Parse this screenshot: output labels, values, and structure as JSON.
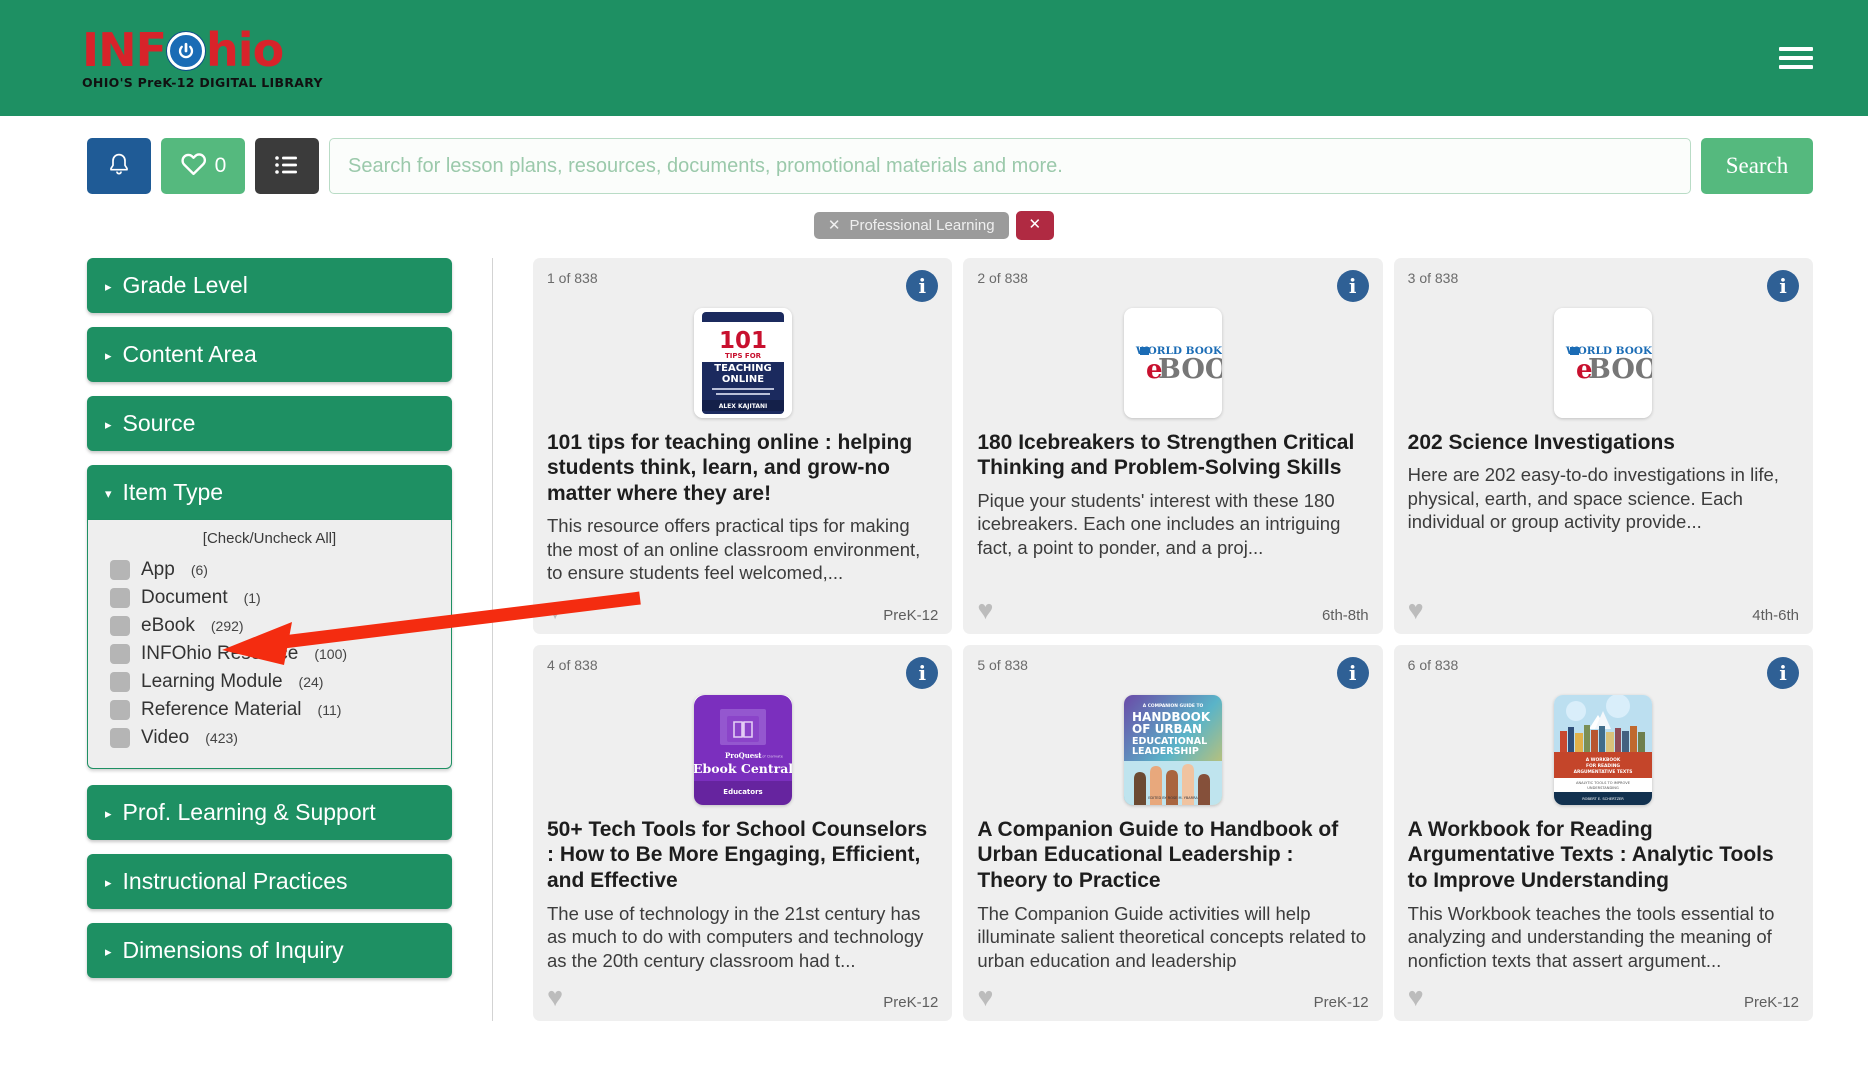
{
  "header": {
    "logo_main": "INF",
    "logo_tail": "hio",
    "logo_icon": "power-icon",
    "logo_tagline": "OHIO'S PreK-12 DIGITAL LIBRARY",
    "menu_icon": "hamburger-icon",
    "brand_green": "#1e9063",
    "brand_red": "#d8232a",
    "brand_blue": "#1a6cb5"
  },
  "search": {
    "notifications_icon": "bell-icon",
    "favorites_icon": "heart-icon",
    "favorites_count": "0",
    "list_icon": "list-icon",
    "placeholder": "Search for lesson plans, resources, documents, promotional materials and more.",
    "value": "",
    "submit_label": "Search"
  },
  "filters": {
    "chips": [
      {
        "label": "Professional Learning",
        "remove_icon": "close-icon"
      }
    ],
    "clear_all_icon": "close-icon",
    "clear_all_color": "#b02a42"
  },
  "sidebar": {
    "facets": [
      {
        "label": "Grade Level",
        "expanded": false,
        "marker": "▸"
      },
      {
        "label": "Content Area",
        "expanded": false,
        "marker": "▸"
      },
      {
        "label": "Source",
        "expanded": false,
        "marker": "▸"
      },
      {
        "label": "Item Type",
        "expanded": true,
        "marker": "▾"
      },
      {
        "label": "Prof. Learning & Support",
        "expanded": false,
        "marker": "▸"
      },
      {
        "label": "Instructional Practices",
        "expanded": false,
        "marker": "▸"
      },
      {
        "label": "Dimensions of Inquiry",
        "expanded": false,
        "marker": "▸"
      }
    ],
    "item_type": {
      "check_all_label": "[Check/Uncheck All]",
      "options": [
        {
          "label": "App",
          "count": "(6)",
          "checked": false
        },
        {
          "label": "Document",
          "count": "(1)",
          "checked": false
        },
        {
          "label": "eBook",
          "count": "(292)",
          "checked": false
        },
        {
          "label": "INFOhio Resource",
          "count": "(100)",
          "checked": false
        },
        {
          "label": "Learning Module",
          "count": "(24)",
          "checked": false
        },
        {
          "label": "Reference Material",
          "count": "(11)",
          "checked": false
        },
        {
          "label": "Video",
          "count": "(423)",
          "checked": false
        }
      ]
    }
  },
  "results": {
    "total": "838",
    "cards": [
      {
        "index": "1 of 838",
        "title": "101 tips for teaching online : helping students think, learn, and grow-no matter where they are!",
        "description": "This resource offers practical tips for making the most of an online classroom environment, to ensure students feel welcomed,...",
        "grade": "PreK-12",
        "thumb": "cover-101-tips",
        "info_icon": "info-icon",
        "favorite_icon": "heart-icon"
      },
      {
        "index": "2 of 838",
        "title": "180 Icebreakers to Strengthen Critical Thinking and Problem-Solving Skills",
        "description": "Pique your students' interest with these 180 icebreakers. Each one includes an intriguing fact, a point to ponder, and a proj...",
        "grade": "6th-8th",
        "thumb": "worldbook-ebook-logo",
        "info_icon": "info-icon",
        "favorite_icon": "heart-icon"
      },
      {
        "index": "3 of 838",
        "title": "202 Science Investigations",
        "description": "Here are 202 easy-to-do investigations in life, physical, earth, and space science. Each individual or group activity provide...",
        "grade": "4th-6th",
        "thumb": "worldbook-ebook-logo",
        "info_icon": "info-icon",
        "favorite_icon": "heart-icon"
      },
      {
        "index": "4 of 838",
        "title": "50+ Tech Tools for School Counselors : How to Be More Engaging, Efficient, and Effective",
        "description": "The use of technology in the 21st century has as much to do with computers and technology as the 20th century classroom had t...",
        "grade": "PreK-12",
        "thumb": "proquest-ebook-central-logo",
        "info_icon": "info-icon",
        "favorite_icon": "heart-icon"
      },
      {
        "index": "5 of 838",
        "title": "A Companion Guide to Handbook of Urban Educational Leadership : Theory to Practice",
        "description": "The Companion Guide activities will help illuminate salient theoretical concepts related to urban education and leadership",
        "grade": "PreK-12",
        "thumb": "cover-urban-leadership",
        "info_icon": "info-icon",
        "favorite_icon": "heart-icon"
      },
      {
        "index": "6 of 838",
        "title": "A Workbook for Reading Argumentative Texts : Analytic Tools to Improve Understanding",
        "description": "This Workbook teaches the tools essential to analyzing and understanding the meaning of nonfiction texts that assert argument...",
        "grade": "PreK-12",
        "thumb": "cover-argumentative-texts",
        "info_icon": "info-icon",
        "favorite_icon": "heart-icon"
      }
    ]
  },
  "annotation": {
    "type": "arrow",
    "color": "#f42c10",
    "points_to": "eBook (292)"
  },
  "thumbs": {
    "worldbook_top": "WORLD BOOK",
    "worldbook_main": "BOOK",
    "worldbook_e": "e",
    "proquest_brand": "ProQuest",
    "proquest_sub": "Part of Clarivate",
    "proquest_main": "Ebook Central",
    "proquest_foot": "Educators",
    "tips_num": "101",
    "tips_for": "TIPS FOR",
    "tips_l1": "TEACHING",
    "tips_l2": "ONLINE",
    "tips_author": "ALEX KAJITANI",
    "urban_l1": "HANDBOOK",
    "urban_l2": "OF URBAN",
    "urban_l3": "EDUCATIONAL",
    "urban_l4": "LEADERSHIP"
  }
}
